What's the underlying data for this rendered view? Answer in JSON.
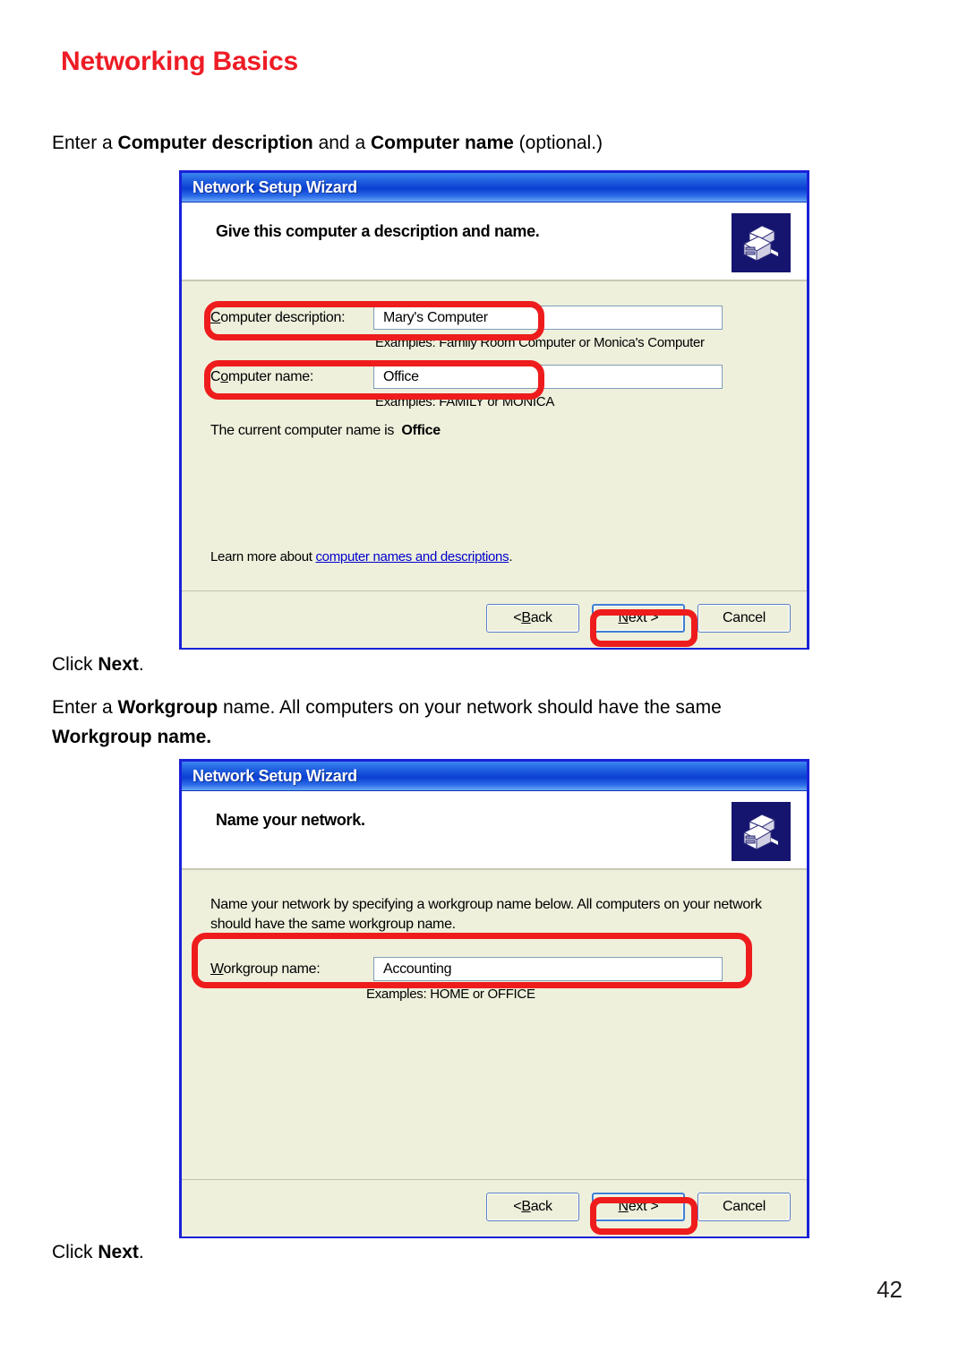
{
  "page": {
    "title": "Networking Basics",
    "number": "42",
    "intro_line": {
      "pre": "Enter a ",
      "bold1": "Computer description",
      "mid": " and a ",
      "bold2": "Computer name",
      "post": " (optional.)"
    },
    "click_next_1": {
      "pre": "Click ",
      "bold": "Next",
      "post": "."
    },
    "workgroup_line": {
      "pre": "Enter a ",
      "bold1": "Workgroup",
      "post": " name.  All computers on your network should have the same",
      "bold2": "Workgroup name."
    },
    "click_next_2": {
      "pre": "Click ",
      "bold": "Next",
      "post": "."
    }
  },
  "dialog1": {
    "title": "Network Setup Wizard",
    "heading": "Give this computer a description and name.",
    "icon": "network-computer-icon",
    "fields": [
      {
        "label_prefix": "",
        "label_accel": "C",
        "label_rest": "omputer description:",
        "value": "Mary's Computer",
        "example": "Examples: Family Room Computer or Monica's Computer"
      },
      {
        "label_prefix": "C",
        "label_accel": "o",
        "label_rest": "mputer name:",
        "value": "Office",
        "example": "Examples: FAMILY or MONICA"
      }
    ],
    "current_name_label": "The current computer name is",
    "current_name_value": "Office",
    "learn_more_prefix": "Learn more about ",
    "learn_more_link": "computer names and descriptions",
    "learn_more_suffix": ".",
    "buttons": {
      "back": {
        "pre": "< ",
        "accel": "B",
        "rest": "ack"
      },
      "next": {
        "accel": "N",
        "rest": "ext >"
      },
      "cancel": {
        "label": "Cancel"
      }
    }
  },
  "dialog2": {
    "title": "Network Setup Wizard",
    "heading": "Name your network.",
    "icon": "network-computer-icon",
    "paragraph": "Name your network by specifying a workgroup name below. All computers on your network should have the same workgroup name.",
    "field": {
      "label_accel": "W",
      "label_rest": "orkgroup name:",
      "value": "Accounting",
      "example": "Examples: HOME or OFFICE"
    },
    "buttons": {
      "back": {
        "pre": "< ",
        "accel": "B",
        "rest": "ack"
      },
      "next": {
        "accel": "N",
        "rest": "ext >"
      },
      "cancel": {
        "label": "Cancel"
      }
    }
  },
  "colors": {
    "brand_red": "#ee1c25",
    "annotation_red": "#ee1c1c",
    "dialog_border_blue": "#1921d8",
    "dialog_body": "#eef0dc",
    "title_gradient_start": "#3b86ef",
    "link_blue": "#0000cc"
  }
}
